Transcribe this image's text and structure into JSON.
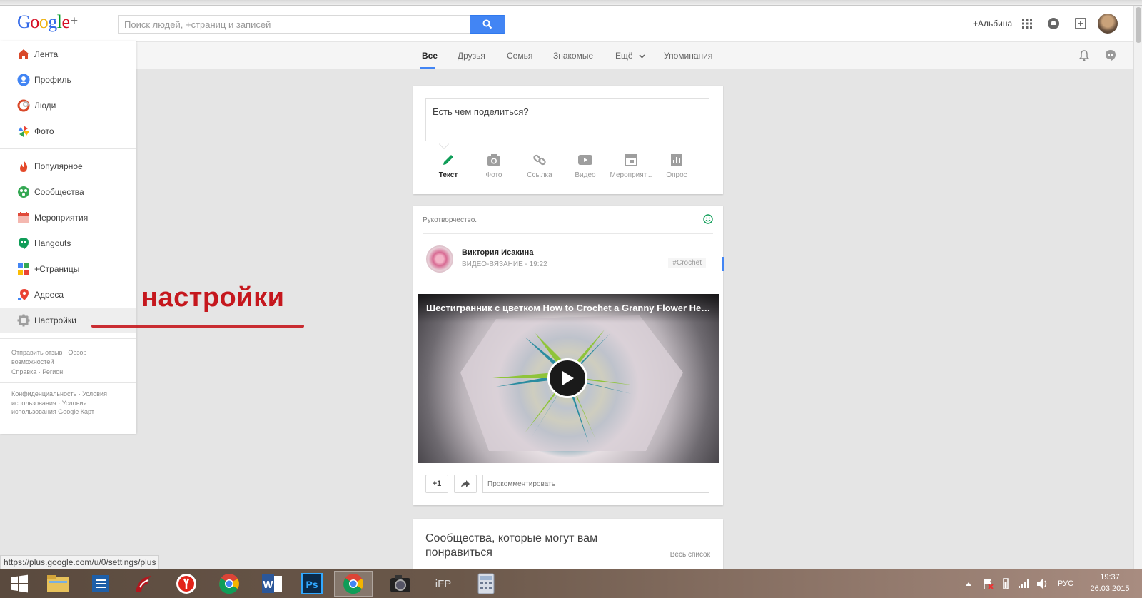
{
  "header": {
    "logo": {
      "g1": "G",
      "g2": "o",
      "g3": "o",
      "g4": "g",
      "g5": "l",
      "g6": "e",
      "plus": "+"
    },
    "search_placeholder": "Поиск людей, +страниц и записей",
    "user_name": "+Альбина"
  },
  "tabs": [
    {
      "label": "Все",
      "active": true
    },
    {
      "label": "Друзья"
    },
    {
      "label": "Семья"
    },
    {
      "label": "Знакомые"
    },
    {
      "label": "Ещё"
    },
    {
      "label": "Упоминания"
    }
  ],
  "sidebar": {
    "items": [
      {
        "label": "Лента",
        "icon": "home-icon"
      },
      {
        "label": "Профиль",
        "icon": "profile-icon"
      },
      {
        "label": "Люди",
        "icon": "people-icon"
      },
      {
        "label": "Фото",
        "icon": "photos-icon"
      },
      {
        "label": "Популярное",
        "icon": "trending-icon"
      },
      {
        "label": "Сообщества",
        "icon": "communities-icon"
      },
      {
        "label": "Мероприятия",
        "icon": "events-icon"
      },
      {
        "label": "Hangouts",
        "icon": "hangouts-icon"
      },
      {
        "label": "+Страницы",
        "icon": "pages-icon"
      },
      {
        "label": "Адреса",
        "icon": "locations-icon"
      },
      {
        "label": "Настройки",
        "icon": "settings-icon",
        "selected": true
      }
    ],
    "footer1": "Отправить отзыв · Обзор возможностей",
    "footer2": "Справка · Регион",
    "footer3": "Конфиденциальность · Условия использования · Условия использования Google Карт"
  },
  "annotation": {
    "text": "настройки",
    "color": "#c5171d"
  },
  "share": {
    "prompt": "Есть чем поделиться?",
    "options": [
      {
        "label": "Текст",
        "icon": "pencil-icon",
        "active": true
      },
      {
        "label": "Фото",
        "icon": "camera-icon"
      },
      {
        "label": "Ссылка",
        "icon": "link-icon"
      },
      {
        "label": "Видео",
        "icon": "video-icon"
      },
      {
        "label": "Мероприят...",
        "icon": "event-icon"
      },
      {
        "label": "Опрос",
        "icon": "poll-icon"
      }
    ]
  },
  "post": {
    "topic": "Рукотворчество.",
    "author": "Виктория Исакина",
    "meta": "ВИДЕО-ВЯЗАНИЕ  -  19:22",
    "tag": "#Crochet",
    "video_title": "Шестигранник с цветком How to Crochet a Granny Flower Hex...",
    "plus_one": "+1",
    "comment_placeholder": "Прокомментировать"
  },
  "communities": {
    "title": "Сообщества, которые могут вам понравиться",
    "link": "Весь список"
  },
  "status_url": "https://plus.google.com/u/0/settings/plus",
  "taskbar": {
    "apps": [
      "windows-start",
      "file-explorer",
      "notes",
      "game",
      "yandex",
      "chrome",
      "word",
      "photoshop",
      "chrome-active",
      "media",
      "ifp",
      "calculator"
    ],
    "ifp_label": "iFP",
    "word_label": "W",
    "ps_label": "Ps",
    "lang": "РУС",
    "time": "19:37",
    "date": "26.03.2015"
  },
  "colors": {
    "accent": "#4285f4",
    "annotation": "#c5171d"
  }
}
